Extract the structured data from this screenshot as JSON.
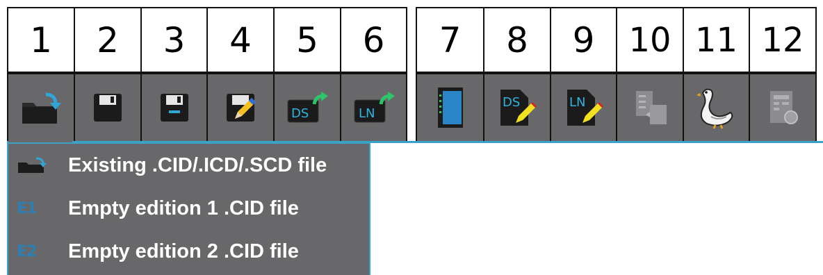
{
  "header_numbers": {
    "group_a": [
      "1",
      "2",
      "3",
      "4",
      "5",
      "6"
    ],
    "group_b": [
      "7",
      "8",
      "9",
      "10",
      "11",
      "12"
    ]
  },
  "toolbar": {
    "icons": [
      {
        "icon": "open-folder-arrow-icon"
      },
      {
        "icon": "save-icon"
      },
      {
        "icon": "save-as-icon"
      },
      {
        "icon": "edit-save-icon"
      },
      {
        "icon": "export-ds-icon",
        "text": "DS"
      },
      {
        "icon": "export-ln-icon",
        "text": "LN"
      },
      {
        "icon": "device-panel-icon"
      },
      {
        "icon": "edit-ds-icon",
        "text": "DS"
      },
      {
        "icon": "edit-ln-icon",
        "text": "LN"
      },
      {
        "icon": "copy-disabled-icon"
      },
      {
        "icon": "goose-icon"
      },
      {
        "icon": "report-disabled-icon"
      }
    ],
    "accent_color": "#3aa3c9",
    "background_color": "#68686a"
  },
  "dropdown": {
    "items": [
      {
        "icon": "folder-arrow-icon",
        "label": "Existing .CID/.ICD/.SCD file"
      },
      {
        "icon": "e1-icon",
        "icon_text": "E1",
        "label": "Empty edition 1 .CID file"
      },
      {
        "icon": "e2-icon",
        "icon_text": "E2",
        "label": "Empty edition 2 .CID file"
      }
    ]
  }
}
